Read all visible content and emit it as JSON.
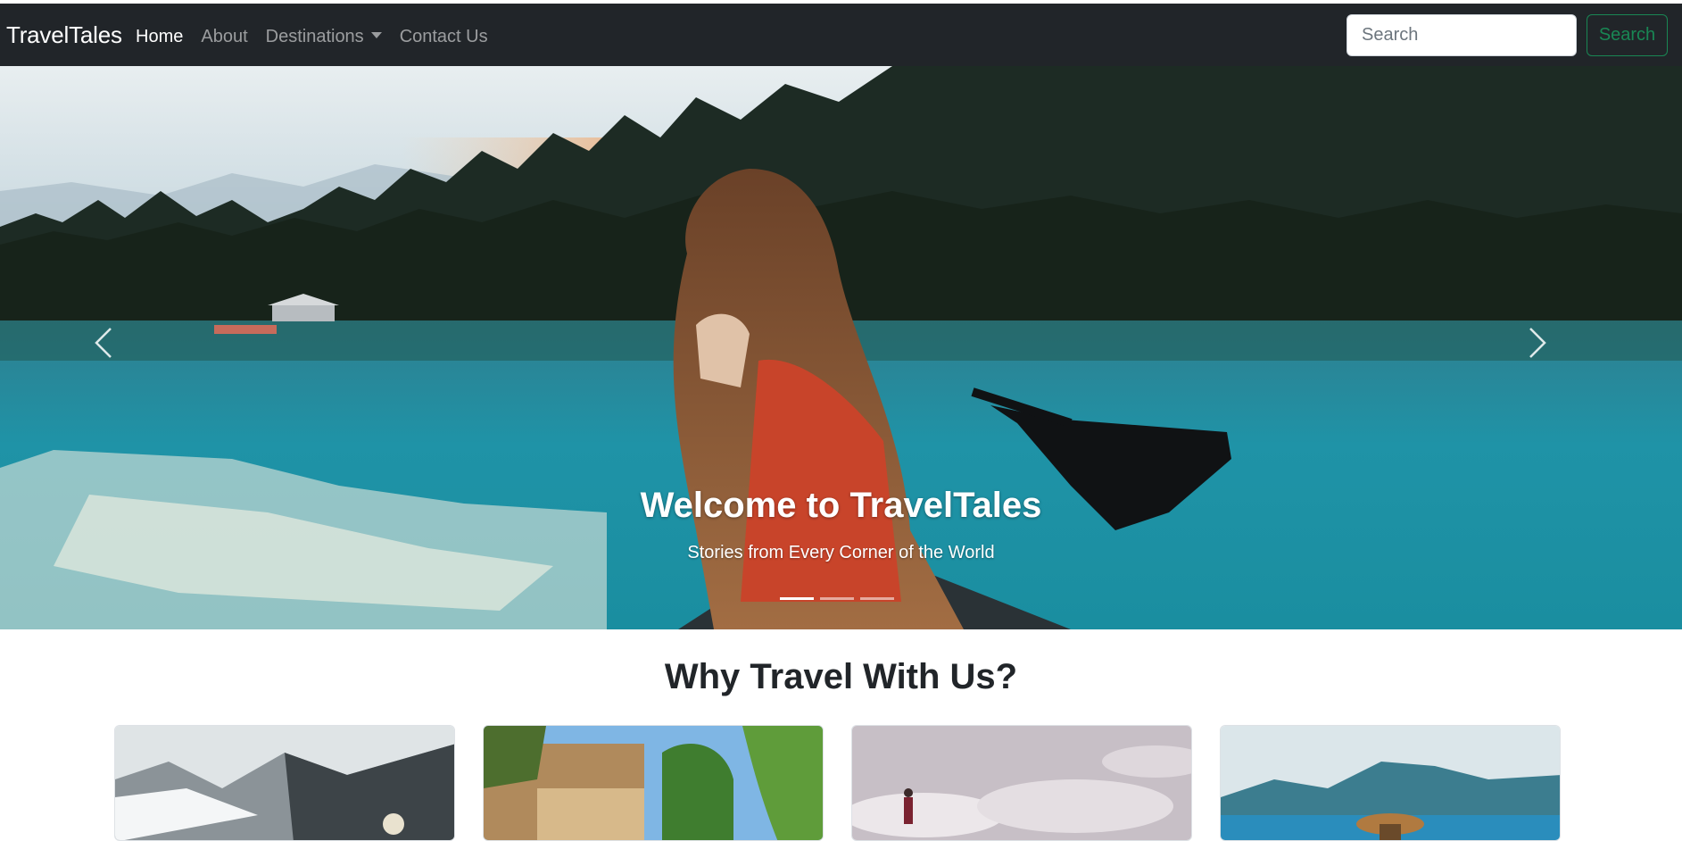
{
  "navbar": {
    "brand": "TravelTales",
    "links": [
      {
        "label": "Home",
        "active": true
      },
      {
        "label": "About",
        "active": false
      },
      {
        "label": "Destinations",
        "active": false,
        "dropdown": true
      },
      {
        "label": "Contact Us",
        "active": false
      }
    ],
    "search": {
      "placeholder": "Search",
      "button_label": "Search"
    }
  },
  "hero": {
    "title": "Welcome to TravelTales",
    "subtitle": "Stories from Every Corner of the World",
    "slide_count": 3,
    "active_slide": 1,
    "prev_icon": "chevron-left-icon",
    "next_icon": "chevron-right-icon"
  },
  "section": {
    "title": "Why Travel With Us?",
    "cards": [
      {
        "image": "snowy-mountain-lake"
      },
      {
        "image": "italian-villa-garden"
      },
      {
        "image": "beach-person-cloudy-sky"
      },
      {
        "image": "woman-hat-sea-view"
      }
    ]
  },
  "colors": {
    "navbar_bg": "#212529",
    "success": "#198754",
    "text": "#212529"
  }
}
